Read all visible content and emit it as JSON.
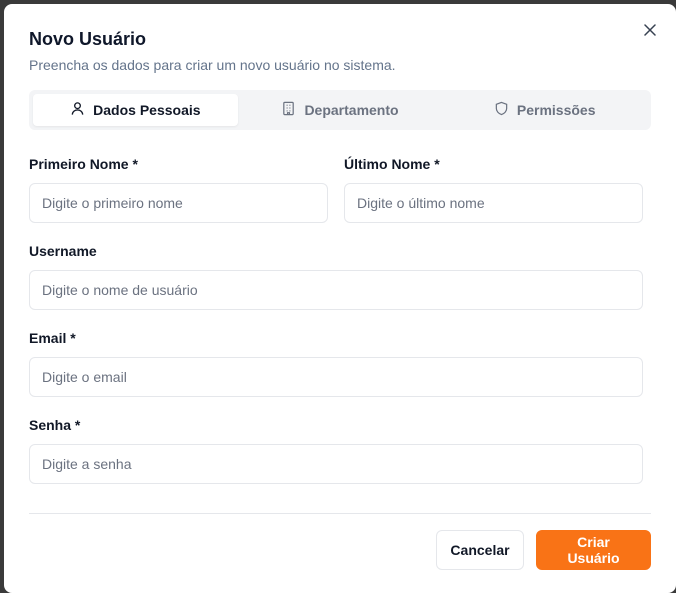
{
  "dialog": {
    "title": "Novo Usuário",
    "subtitle": "Preencha os dados para criar um novo usuário no sistema.",
    "close_icon": "close-icon"
  },
  "tabs": [
    {
      "label": "Dados Pessoais",
      "icon": "user-icon",
      "active": true
    },
    {
      "label": "Departamento",
      "icon": "building-icon",
      "active": false
    },
    {
      "label": "Permissões",
      "icon": "shield-icon",
      "active": false
    }
  ],
  "form": {
    "first_name": {
      "label": "Primeiro Nome *",
      "placeholder": "Digite o primeiro nome",
      "value": ""
    },
    "last_name": {
      "label": "Último Nome *",
      "placeholder": "Digite o último nome",
      "value": ""
    },
    "username": {
      "label": "Username",
      "placeholder": "Digite o nome de usuário",
      "value": ""
    },
    "email": {
      "label": "Email *",
      "placeholder": "Digite o email",
      "value": ""
    },
    "password": {
      "label": "Senha *",
      "placeholder": "Digite a senha",
      "value": ""
    }
  },
  "footer": {
    "cancel_label": "Cancelar",
    "submit_label": "Criar Usuário"
  },
  "colors": {
    "accent": "#f97316",
    "overlay": "#3a3a3a"
  }
}
